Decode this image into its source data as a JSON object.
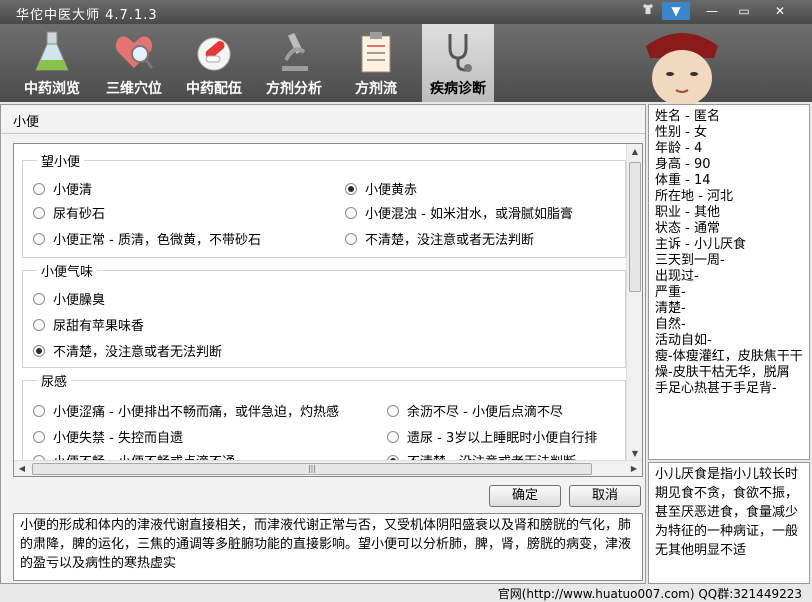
{
  "window": {
    "title": "华佗中医大师 4.7.1.3",
    "controls": [
      "shirt-icon",
      "dropdown-icon",
      "minimize-icon",
      "maximize-icon",
      "close-icon"
    ]
  },
  "toolbar": {
    "tools": [
      {
        "label": "中药浏览",
        "icon": "flask-icon"
      },
      {
        "label": "三维穴位",
        "icon": "heart-magnifier-icon"
      },
      {
        "label": "中药配伍",
        "icon": "pill-icon"
      },
      {
        "label": "方剂分析",
        "icon": "microscope-icon"
      },
      {
        "label": "方剂流",
        "icon": "clipboard-icon"
      },
      {
        "label": "疾病诊断",
        "icon": "stethoscope-icon"
      }
    ]
  },
  "main": {
    "breadcrumb": "小便",
    "groups": [
      {
        "title": "望小便",
        "options": [
          "小便清",
          "小便黄赤",
          "尿有砂石",
          "小便混浊 - 如米泔水，或滑腻如脂膏",
          "小便正常 - 质清，色微黄，不带砂石",
          "不清楚，没注意或者无法判断"
        ]
      },
      {
        "title": "小便气味",
        "options": [
          "小便臊臭",
          "尿甜有苹果味香",
          "不清楚，没注意或者无法判断"
        ]
      },
      {
        "title": "尿感",
        "options": [
          "小便涩痛 - 小便排出不畅而痛，或伴急迫，灼热感",
          "余沥不尽 - 小便后点滴不尽",
          "小便失禁 - 失控而自遗",
          "遗尿 - 3岁以上睡眠时小便自行排",
          "小便不畅 - 小便不畅或点滴不通",
          "不清楚，没注意或者无法判断"
        ]
      }
    ],
    "selected": [
      "小便黄赤",
      "不清楚，没注意或者无法判断(小便气味)",
      "不清楚，没注意或者无法判断(尿感)"
    ],
    "ok_label": "确定",
    "cancel_label": "取消",
    "description": "小便的形成和体内的津液代谢直接相关，而津液代谢正常与否，又受机体阴阳盛衰以及肾和膀胱的气化，肺的肃降，脾的运化，三焦的通调等多脏腑功能的直接影响。望小便可以分析肺，脾，肾，膀胱的病变，津液的盈亏以及病性的寒热虚实"
  },
  "patient": {
    "lines": [
      "姓名 - 匿名",
      "性别 - 女",
      "年龄 - 4",
      "身高 - 90",
      "体重 - 14",
      "所在地 - 河北",
      "职业 - 其他",
      "状态 - 通常",
      "主诉 - 小儿厌食",
      "三天到一周-",
      "出现过-",
      "严重-",
      "清楚-",
      "自然-",
      "活动自如-",
      "瘦-体瘦灌红，皮肤焦干干燥-皮肤干枯无华，脱屑",
      "手足心热甚于手足背-"
    ]
  },
  "note": "小儿厌食是指小儿较长时期见食不贪，食欲不振，甚至厌恶进食，食量减少为特征的一种病证，一般无其他明显不适",
  "status": "官网(http://www.huatuo007.com) QQ群:321449223"
}
